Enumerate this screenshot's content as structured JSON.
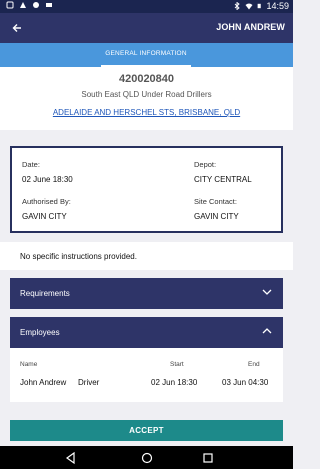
{
  "status_bar": {
    "time": "14:59",
    "left_icons": [
      "notification-icon",
      "signal-app-icon",
      "data-icon",
      "message-icon"
    ],
    "right_icons": [
      "bluetooth-icon",
      "wifi-icon",
      "battery-icon"
    ]
  },
  "app_bar": {
    "back_icon": "back-arrow-icon",
    "user_name": "JOHN ANDREW"
  },
  "tabs": [
    {
      "label": "GENERAL INFORMATION",
      "active": true
    }
  ],
  "job": {
    "number": "420020840",
    "subtitle": "South East QLD Under Road Drillers",
    "address": "ADELAIDE AND HERSCHEL STS, BRISBANE, QLD"
  },
  "details": {
    "date_label": "Date:",
    "date_value": "02 June 18:30",
    "depot_label": "Depot:",
    "depot_value": "CITY CENTRAL",
    "authorised_label": "Authorised By:",
    "authorised_value": "GAVIN CITY",
    "site_contact_label": "Site Contact:",
    "site_contact_value": "GAVIN CITY"
  },
  "instructions": "No specific instructions provided.",
  "requirements": {
    "title": "Requirements",
    "expanded": false
  },
  "employees": {
    "title": "Employees",
    "expanded": true,
    "columns": [
      "Name",
      "Start",
      "End"
    ],
    "rows": [
      {
        "name": "John Andrew",
        "role": "Driver",
        "start": "02 Jun 18:30",
        "end": "03 Jun 04:30"
      }
    ]
  },
  "accept_label": "ACCEPT",
  "colors": {
    "status_bar": "#1b2550",
    "app_bar": "#2e3468",
    "tab_bar": "#4a97dc",
    "link": "#1e56b9",
    "accept": "#1d8a8a",
    "background": "#efeff3"
  }
}
